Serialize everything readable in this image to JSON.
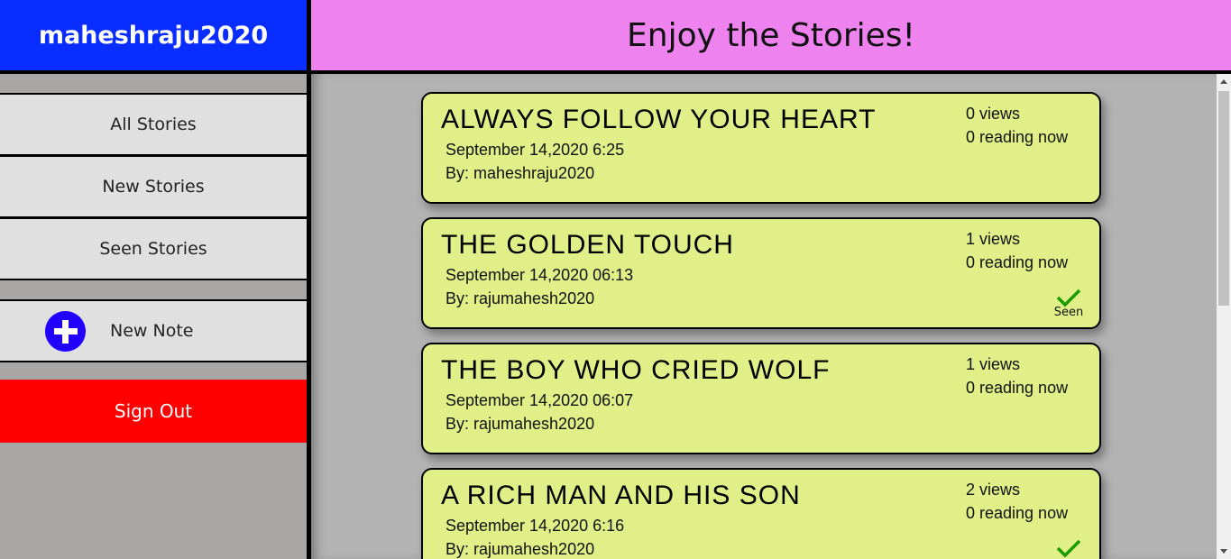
{
  "sidebar": {
    "username": "maheshraju2020",
    "nav": [
      {
        "label": "All Stories"
      },
      {
        "label": "New Stories"
      },
      {
        "label": "Seen Stories"
      }
    ],
    "new_note_label": "New Note",
    "sign_out_label": "Sign Out",
    "colors": {
      "brand_bg": "#0a2dff",
      "sign_out_bg": "#ff0000",
      "plus_button": "#2200ff"
    }
  },
  "header": {
    "title": "Enjoy the Stories!",
    "bg_color": "#ee82ee"
  },
  "stories": [
    {
      "title": "ALWAYS FOLLOW YOUR HEART",
      "date": "September 14,2020 6:25",
      "author": "By: maheshraju2020",
      "views": "0 views",
      "reading": "0 reading now",
      "seen": false
    },
    {
      "title": "THE GOLDEN TOUCH",
      "date": "September 14,2020 06:13",
      "author": "By: rajumahesh2020",
      "views": "1 views",
      "reading": "0 reading now",
      "seen": true,
      "seen_label": "Seen"
    },
    {
      "title": "THE BOY WHO CRIED WOLF",
      "date": "September 14,2020 06:07",
      "author": "By: rajumahesh2020",
      "views": "1 views",
      "reading": "0 reading now",
      "seen": false
    },
    {
      "title": "A RICH MAN AND HIS SON",
      "date": "September 14,2020 6:16",
      "author": "By: rajumahesh2020",
      "views": "2 views",
      "reading": "0 reading now",
      "seen": true
    }
  ],
  "card_color": "#e0ef88",
  "check_color": "#1a9a00"
}
